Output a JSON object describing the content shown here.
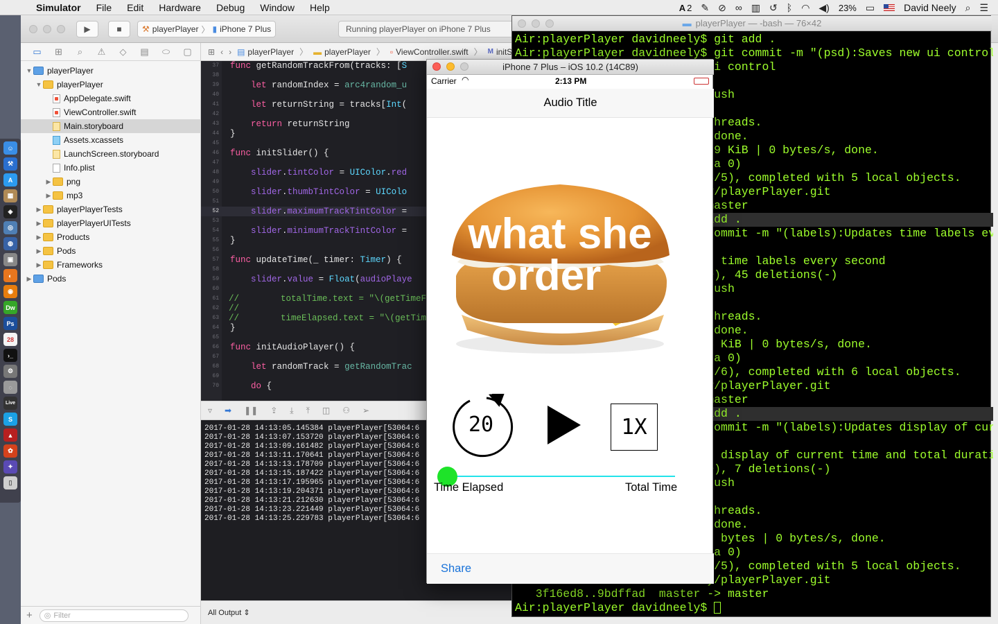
{
  "menubar": {
    "app_name": "Simulator",
    "menus": [
      "File",
      "Edit",
      "Hardware",
      "Debug",
      "Window",
      "Help"
    ],
    "adobe_count": "2",
    "battery": "23%",
    "user": "David Neely"
  },
  "xcode": {
    "scheme_app": "playerPlayer",
    "scheme_device": "iPhone 7 Plus",
    "activity": "Running playerPlayer on iPhone 7 Plus",
    "jumpbar": [
      "playerPlayer",
      "playerPlayer",
      "ViewController.swift",
      "initS"
    ],
    "tree": [
      {
        "label": "playerPlayer",
        "kind": "project",
        "depth": 0,
        "open": true
      },
      {
        "label": "playerPlayer",
        "kind": "folder",
        "depth": 1,
        "open": true
      },
      {
        "label": "AppDelegate.swift",
        "kind": "swift",
        "depth": 2
      },
      {
        "label": "ViewController.swift",
        "kind": "swift",
        "depth": 2
      },
      {
        "label": "Main.storyboard",
        "kind": "sb",
        "depth": 2,
        "selected": true
      },
      {
        "label": "Assets.xcassets",
        "kind": "assets",
        "depth": 2
      },
      {
        "label": "LaunchScreen.storyboard",
        "kind": "sb",
        "depth": 2
      },
      {
        "label": "Info.plist",
        "kind": "plist",
        "depth": 2
      },
      {
        "label": "png",
        "kind": "folder",
        "depth": 2,
        "closed": true
      },
      {
        "label": "mp3",
        "kind": "folder",
        "depth": 2,
        "closed": true
      },
      {
        "label": "playerPlayerTests",
        "kind": "folder",
        "depth": 1,
        "closed": true
      },
      {
        "label": "playerPlayerUITests",
        "kind": "folder",
        "depth": 1,
        "closed": true
      },
      {
        "label": "Products",
        "kind": "folder",
        "depth": 1,
        "closed": true
      },
      {
        "label": "Pods",
        "kind": "folder",
        "depth": 1,
        "closed": true
      },
      {
        "label": "Frameworks",
        "kind": "folder",
        "depth": 1,
        "closed": true
      },
      {
        "label": "Pods",
        "kind": "project",
        "depth": 0,
        "closed": true
      }
    ],
    "filter_placeholder": "Filter",
    "console_scope": "All Output",
    "console_lines": [
      "2017-01-28 14:13:05.145384 playerPlayer[53064:6",
      "2017-01-28 14:13:07.153720 playerPlayer[53064:6",
      "2017-01-28 14:13:09.161482 playerPlayer[53064:6",
      "2017-01-28 14:13:11.170641 playerPlayer[53064:6",
      "2017-01-28 14:13:13.178709 playerPlayer[53064:6",
      "2017-01-28 14:13:15.187422 playerPlayer[53064:6",
      "2017-01-28 14:13:17.195965 playerPlayer[53064:6",
      "2017-01-28 14:13:19.204371 playerPlayer[53064:6",
      "2017-01-28 14:13:21.212630 playerPlayer[53064:6",
      "2017-01-28 14:13:23.221449 playerPlayer[53064:6",
      "2017-01-28 14:13:25.229783 playerPlayer[53064:6"
    ]
  },
  "code": {
    "l37": "37",
    "l38": "38",
    "l39": "39",
    "l40": "40",
    "l41": "41",
    "l42": "42",
    "l43": "43",
    "l44": "44",
    "l45": "45",
    "l46": "46",
    "l47": "47",
    "l48": "48",
    "l49": "49",
    "l50": "50",
    "l51": "51",
    "l52": "52",
    "l53": "53",
    "l54": "54",
    "l55": "55",
    "l56": "56",
    "l57": "57",
    "l58": "58",
    "l59": "59",
    "l60": "60",
    "l61": "61",
    "l62": "62",
    "l63": "63",
    "l64": "64",
    "l65": "65",
    "l66": "66",
    "l67": "67",
    "l68": "68",
    "l69": "69",
    "l70": "70"
  },
  "terminal": {
    "title": "playerPlayer — -bash — 76×42",
    "lines": [
      "Air:playerPlayer davidneely$ git add .",
      "Air:playerPlayer davidneely$ git commit -m \"(psd):Saves new ui control\"",
      "                            ui control",
      "                            )",
      "                            push",
      "",
      "                            threads.",
      "                             done.",
      "                            79 KiB | 0 bytes/s, done.",
      "                            ta 0)",
      "                            5/5), completed with 5 local objects.",
      "                            y/playerPlayer.git",
      "                            master",
      "                            add .",
      "                            commit -m \"(labels):Updates time labels eve",
      "",
      "                            s time labels every second",
      "                            +), 45 deletions(-)",
      "                            push",
      "",
      "                            threads.",
      "                             done.",
      "                            3 KiB | 0 bytes/s, done.",
      "                            ta 0)",
      "                            6/6), completed with 6 local objects.",
      "                            y/playerPlayer.git",
      "                            master",
      "                            add .",
      "                            commit -m \"(labels):Updates display of curr",
      "",
      "                            s display of current time and total duration",
      "                            +), 7 deletions(-)",
      "                            push",
      "",
      "                            threads.",
      "                             done.",
      "                            s bytes | 0 bytes/s, done.",
      "                            ta 0)",
      "                            5/5), completed with 5 local objects.",
      "                            y/playerPlayer.git",
      "   3f16ed8..9bdffad  master -> master",
      "Air:playerPlayer davidneely$ "
    ]
  },
  "simulator": {
    "title": "iPhone 7 Plus – iOS 10.2 (14C89)",
    "carrier": "Carrier",
    "time": "2:13 PM",
    "nav_title": "Audio Title",
    "artwork_text_line1": "what she",
    "artwork_text_line2": "order",
    "skip_seconds": "20",
    "rate": "1X",
    "progress_fraction": 0.0,
    "time_elapsed_label": "Time Elapsed",
    "total_time_label": "Total Time",
    "share_label": "Share",
    "slider_min_color": "#22e3ea",
    "slider_thumb_color": "#1ee329"
  }
}
